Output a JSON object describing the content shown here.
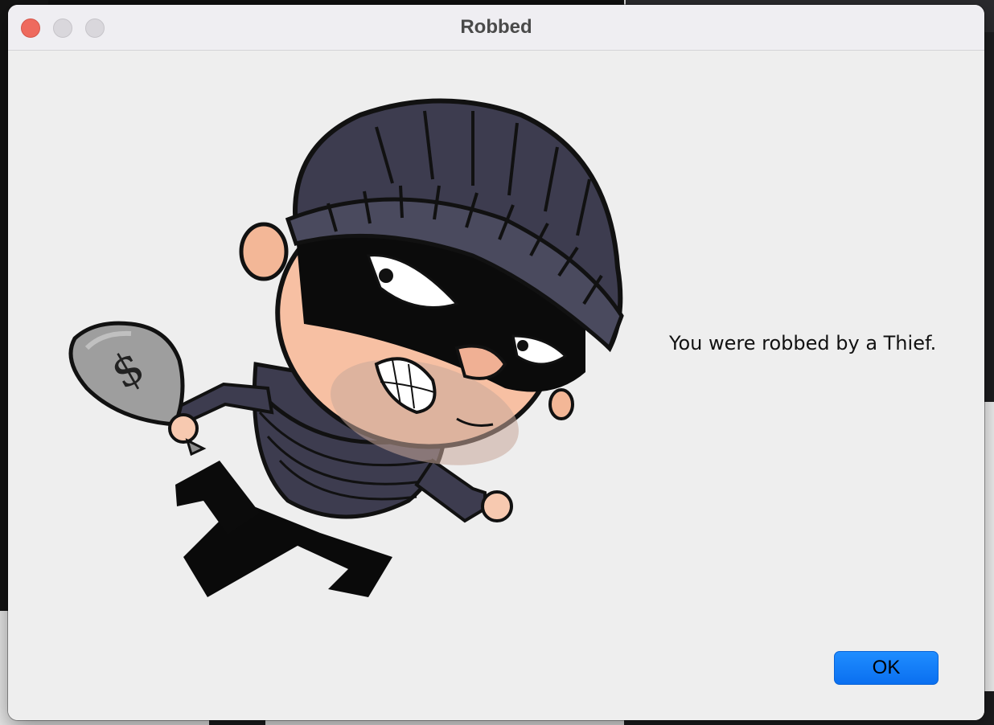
{
  "window": {
    "title": "Robbed"
  },
  "dialog": {
    "message": "You were robbed by a Thief.",
    "image": "thief-cartoon",
    "bag_symbol": "$",
    "ok_label": "OK"
  },
  "colors": {
    "accent": "#0a6ff0",
    "close": "#ee6a5e",
    "dialog_background": "#eeeeee"
  }
}
